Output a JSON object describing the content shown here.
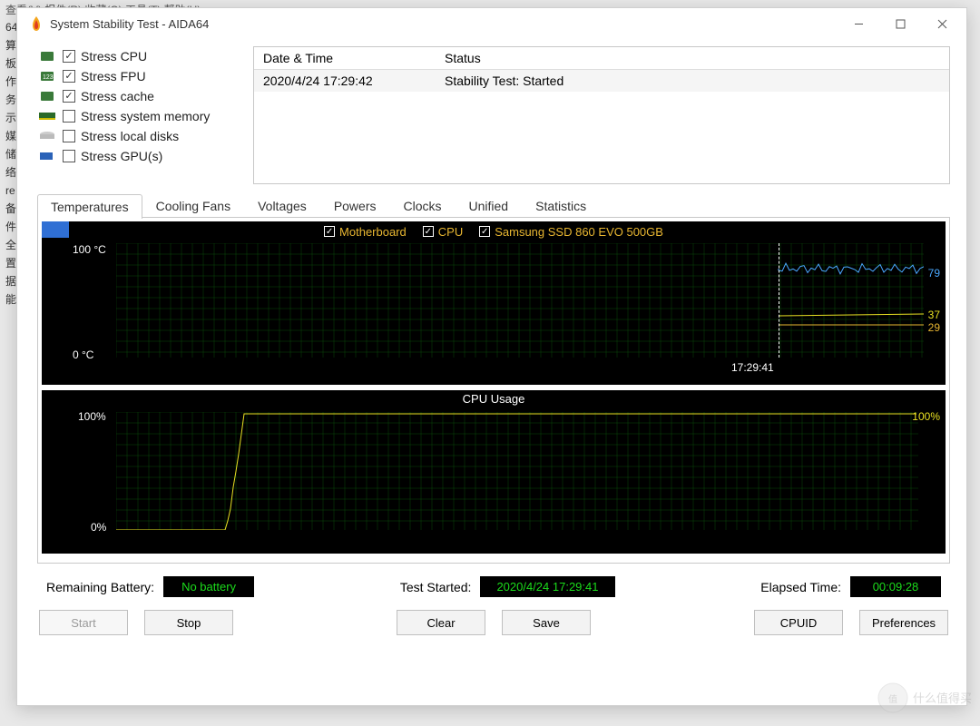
{
  "window": {
    "title": "System Stability Test - AIDA64"
  },
  "backdrop": {
    "menu_hint": "查看(V)  报件(R)  收藏(O)  工具(T)  帮助(H)",
    "side_items": [
      "64",
      "算",
      "板",
      "作",
      "务",
      "示",
      "媒",
      "储",
      "络",
      "re",
      "备",
      "件",
      "全",
      "置",
      "据",
      "能"
    ]
  },
  "stress_options": [
    {
      "label": "Stress CPU",
      "checked": true,
      "icon": "cpu"
    },
    {
      "label": "Stress FPU",
      "checked": true,
      "icon": "fpu"
    },
    {
      "label": "Stress cache",
      "checked": true,
      "icon": "cache"
    },
    {
      "label": "Stress system memory",
      "checked": false,
      "icon": "ram"
    },
    {
      "label": "Stress local disks",
      "checked": false,
      "icon": "disk"
    },
    {
      "label": "Stress GPU(s)",
      "checked": false,
      "icon": "gpu"
    }
  ],
  "log": {
    "headers": {
      "dt": "Date & Time",
      "st": "Status"
    },
    "rows": [
      {
        "dt": "2020/4/24 17:29:42",
        "st": "Stability Test: Started"
      }
    ]
  },
  "tabs": [
    "Temperatures",
    "Cooling Fans",
    "Voltages",
    "Powers",
    "Clocks",
    "Unified",
    "Statistics"
  ],
  "active_tab": 0,
  "graph_temp": {
    "legend": [
      "Motherboard",
      "CPU",
      "Samsung SSD 860 EVO 500GB"
    ],
    "y_top": "100 °C",
    "y_bot": "0 °C",
    "readings": {
      "cpu": "79",
      "mb": "37",
      "ssd": "29"
    },
    "marker_time": "17:29:41"
  },
  "graph_cpu": {
    "title": "CPU Usage",
    "y_top": "100%",
    "y_bot": "0%",
    "value_label": "100%"
  },
  "chart_data": [
    {
      "type": "line",
      "title": "Temperatures",
      "ylabel": "°C",
      "ylim": [
        0,
        100
      ],
      "x_marker": "17:29:41",
      "series": [
        {
          "name": "CPU",
          "current": 79,
          "color": "#4aa8ff"
        },
        {
          "name": "Motherboard",
          "current": 37,
          "color": "#e8e022"
        },
        {
          "name": "Samsung SSD 860 EVO 500GB",
          "current": 29,
          "color": "#e8b631"
        }
      ]
    },
    {
      "type": "line",
      "title": "CPU Usage",
      "ylabel": "%",
      "ylim": [
        0,
        100
      ],
      "series": [
        {
          "name": "CPU Usage",
          "current": 100,
          "color": "#e8e022"
        }
      ]
    }
  ],
  "status": {
    "battery_label": "Remaining Battery:",
    "battery_value": "No battery",
    "started_label": "Test Started:",
    "started_value": "2020/4/24 17:29:41",
    "elapsed_label": "Elapsed Time:",
    "elapsed_value": "00:09:28"
  },
  "buttons": {
    "start": "Start",
    "stop": "Stop",
    "clear": "Clear",
    "save": "Save",
    "cpuid": "CPUID",
    "prefs": "Preferences"
  },
  "watermark": "什么值得买"
}
